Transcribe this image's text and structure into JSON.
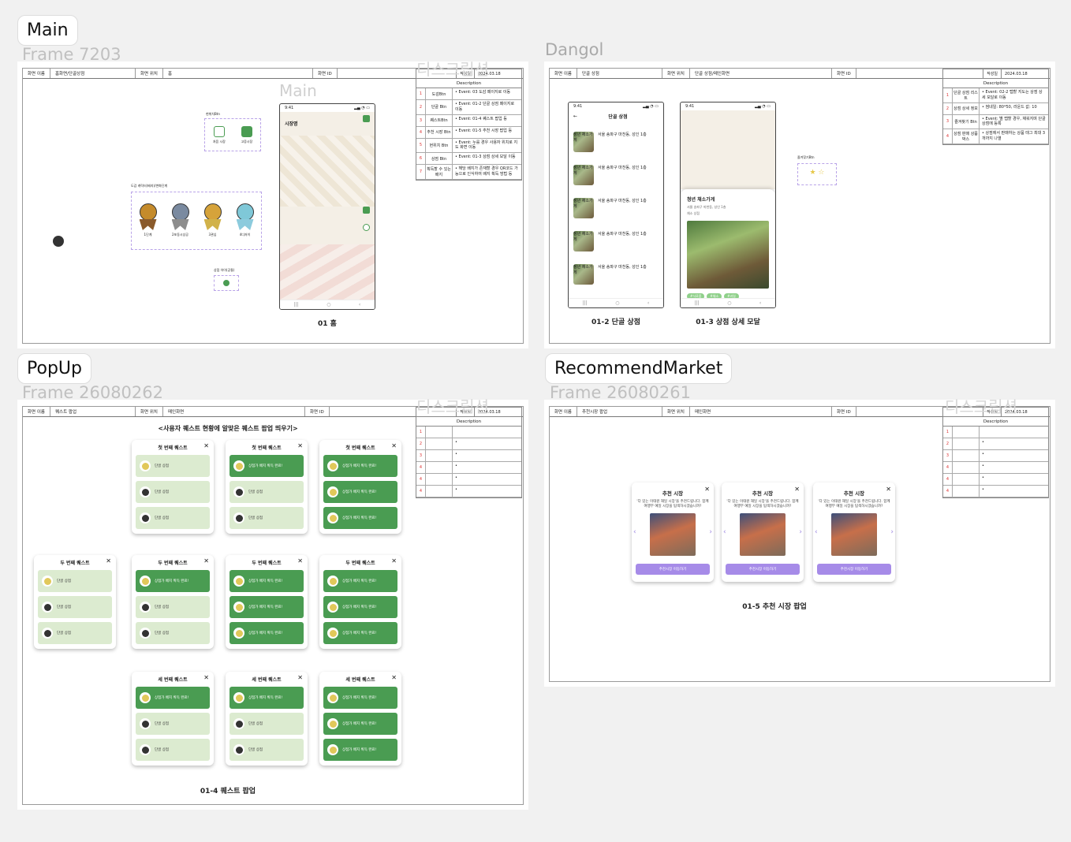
{
  "sections": {
    "main": {
      "tag": "Main",
      "frame": "Frame 7203",
      "ghost": "디스크립션",
      "phone_ghost": "Main"
    },
    "dangol": {
      "frame": "Dangol"
    },
    "popup": {
      "tag": "PopUp",
      "frame": "Frame 26080262",
      "ghost": "디스크립션"
    },
    "recommend": {
      "tag": "RecommendMarket",
      "frame": "Frame 26080261",
      "ghost": "디스크립션"
    }
  },
  "headers": {
    "main": {
      "name_label": "화면 이름",
      "name": "홈화면/단골상점",
      "pos_label": "화면 위치",
      "pos": "홈",
      "id_label": "화면 ID",
      "date_label": "작성일",
      "date": "2024.03.18"
    },
    "dangol": {
      "name_label": "화면 이름",
      "name": "단골 상점",
      "pos_label": "화면 위치",
      "pos": "단골 상점/메인화면",
      "id_label": "화면 ID",
      "date_label": "작성일",
      "date": "2024.03.18"
    },
    "popup": {
      "name_label": "화면 이름",
      "name": "퀘스트 팝업",
      "pos_label": "화면 위치",
      "pos": "메인화면",
      "id_label": "화면 ID",
      "date_label": "작성일",
      "date": "2024.03.18"
    },
    "recommend": {
      "name_label": "화면 이름",
      "name": "추천시장 팝업",
      "pos_label": "화면 위치",
      "pos": "메인화면",
      "id_label": "화면 ID",
      "date_label": "작성일",
      "date": "2024.03.18"
    }
  },
  "description_title": "Description",
  "main_desc": [
    {
      "n": "1",
      "l": "도감Btn",
      "t": "• Event: 03 도감 페이지로 이동"
    },
    {
      "n": "2",
      "l": "단골 Btn",
      "t": "• Event: 01-2 단골 상점 페이지로 이동"
    },
    {
      "n": "3",
      "l": "퀘스트Btn",
      "t": "• Event: 01-4 퀘스트 팝업 등"
    },
    {
      "n": "4",
      "l": "추천 시장 Btn",
      "t": "• Event: 01-5 추천 시장 팝업 등"
    },
    {
      "n": "5",
      "l": "현위치 Btn",
      "t": "• Event: 누를 경우 사용자 위치로 지도 화면 이동"
    },
    {
      "n": "6",
      "l": "상점 Btn",
      "t": "• Event: 01-3 상점 상세 모달 이동"
    },
    {
      "n": "7",
      "l": "획득할 수 있는 배지",
      "t": "• 해당 배지가 존재할 경우 QR코드 가능으로 인식하여 배지 획득 방법 등"
    }
  ],
  "dangol_desc": [
    {
      "n": "1",
      "l": "단골 상점 리스트",
      "t": "• Event: 02-2 탭할 지도는 상점 상세 모달로 이동"
    },
    {
      "n": "2",
      "l": "상점 상세 정보",
      "t": "• 썸네일: 80*50, 라운드 값: 10"
    },
    {
      "n": "3",
      "l": "즐겨찾기 Btn",
      "t": "• Event: 별 탭할 경우, 채워지며 단골 상점에 등록"
    },
    {
      "n": "4",
      "l": "상점 판매 상품 박스",
      "t": "• 상점에서 판매하는 상품 태그 최대 3개까지 나열"
    }
  ],
  "empty_desc": [
    {
      "n": "1",
      "t": ""
    },
    {
      "n": "2",
      "t": "•"
    },
    {
      "n": "3",
      "t": "•"
    },
    {
      "n": "4",
      "t": "•"
    },
    {
      "n": "4",
      "t": "•"
    },
    {
      "n": "4",
      "t": "•"
    }
  ],
  "main_screen": {
    "time": "9:41",
    "map_title": "시장명",
    "caption": "01 홈",
    "widget_label": "현위치Btn",
    "widget_items": [
      "처음 시장",
      "고증시장"
    ],
    "characters_label": "도감 캐릭터(배지)/변화단계",
    "characters": [
      "1단계",
      "2포동시상공",
      "3관심",
      "4디저이"
    ],
    "badge_label": "상점 아이(공통)"
  },
  "dangol_screen": {
    "time": "9:41",
    "title": "단골 상점",
    "caption_list": "01-2 단골 상점",
    "caption_modal": "01-3 상점 상세 모달",
    "store_name": "청년 채소가게",
    "store_addr": "서울 송파구 마천동, 성인 1층",
    "store_type": "채소 상점",
    "modal_store": "청년 채소가게",
    "favorite_label": "즐겨찾기Btn",
    "tags": [
      "#식료품",
      "#채소",
      "#과일"
    ]
  },
  "popup_screen": {
    "title": "<사용자 퀘스트 현황에 알맞은 퀘스트 팝업 띄우기>",
    "caption": "01-4 퀘스트 팝업",
    "q1": "첫 번째 퀘스트",
    "q2": "두 번째 퀘스트",
    "q3": "세 번째 퀘스트",
    "item_g": "상점가 배지 획득 완료!",
    "item_l": "단골 상점"
  },
  "recommend_screen": {
    "caption": "01-5 추천 시장 팝업",
    "card_title": "추천 시장",
    "card_sub": "'다 있는 이태원 재일 시장'을 추천드립니다. 함께 여행부 예일 시장을 탐색하시겠습니까?",
    "card_btn": "추천시장 이동하기"
  },
  "colors": {
    "accent_green": "#4a9c52",
    "accent_purple": "#a68be8",
    "index_red": "#d33333"
  }
}
